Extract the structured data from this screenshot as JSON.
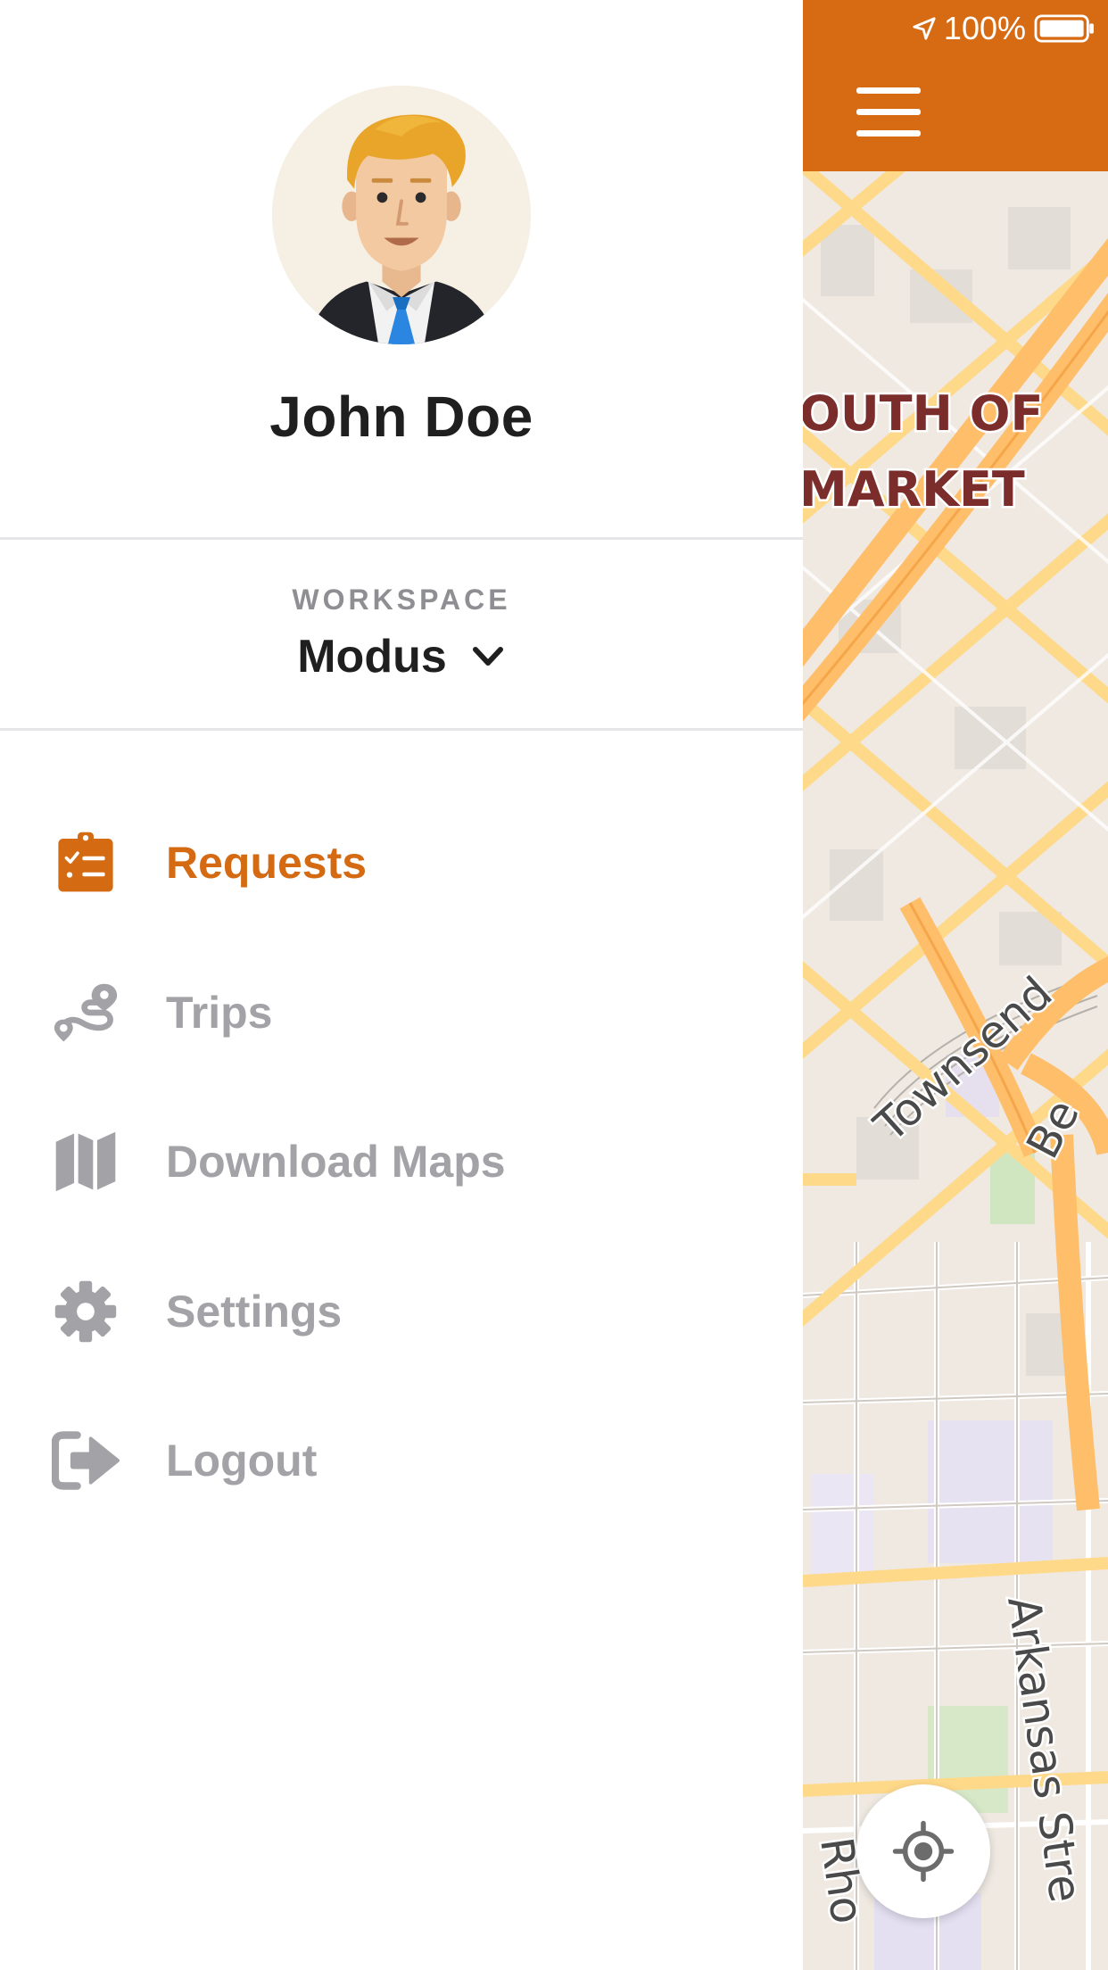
{
  "status_bar": {
    "battery_text": "100%",
    "icons": [
      "location-arrow-icon",
      "battery-icon"
    ]
  },
  "user": {
    "name": "John Doe",
    "avatar_icon": "user-avatar-icon"
  },
  "workspace": {
    "label": "WORKSPACE",
    "value": "Modus",
    "icon": "chevron-down-icon"
  },
  "menu": {
    "items": [
      {
        "label": "Requests",
        "icon": "clipboard-checklist-icon",
        "active": true
      },
      {
        "label": "Trips",
        "icon": "route-icon",
        "active": false
      },
      {
        "label": "Download Maps",
        "icon": "map-icon",
        "active": false
      },
      {
        "label": "Settings",
        "icon": "gear-icon",
        "active": false
      },
      {
        "label": "Logout",
        "icon": "logout-icon",
        "active": false
      }
    ]
  },
  "map": {
    "labels": [
      "OUTH OF",
      "MARKET",
      "Townsend",
      "Be",
      "Arkansas Stre",
      "Rho"
    ],
    "controls": [
      "menu-icon",
      "locate-crosshair-icon"
    ]
  },
  "colors": {
    "accent": "#d46a12",
    "header": "#d76b14",
    "inactive_text": "#a2a2a7",
    "map_background": "#efe9e2",
    "road_major": "#ffc86e"
  }
}
